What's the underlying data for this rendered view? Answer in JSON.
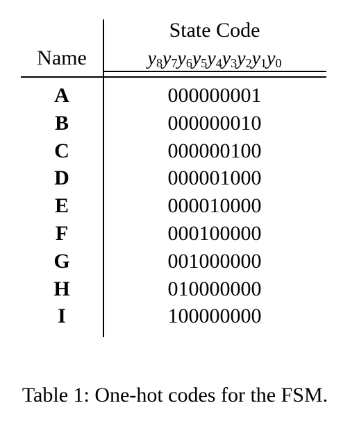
{
  "table": {
    "header": {
      "name_label": "Name",
      "code_label": "State Code",
      "bit_symbol": "y",
      "bit_indices": [
        "8",
        "7",
        "6",
        "5",
        "4",
        "3",
        "2",
        "1",
        "0"
      ]
    },
    "rows": [
      {
        "name": "A",
        "code": "000000001"
      },
      {
        "name": "B",
        "code": "000000010"
      },
      {
        "name": "C",
        "code": "000000100"
      },
      {
        "name": "D",
        "code": "000001000"
      },
      {
        "name": "E",
        "code": "000010000"
      },
      {
        "name": "F",
        "code": "000100000"
      },
      {
        "name": "G",
        "code": "001000000"
      },
      {
        "name": "H",
        "code": "010000000"
      },
      {
        "name": "I",
        "code": "100000000"
      }
    ]
  },
  "caption": "Table 1: One-hot codes for the FSM."
}
